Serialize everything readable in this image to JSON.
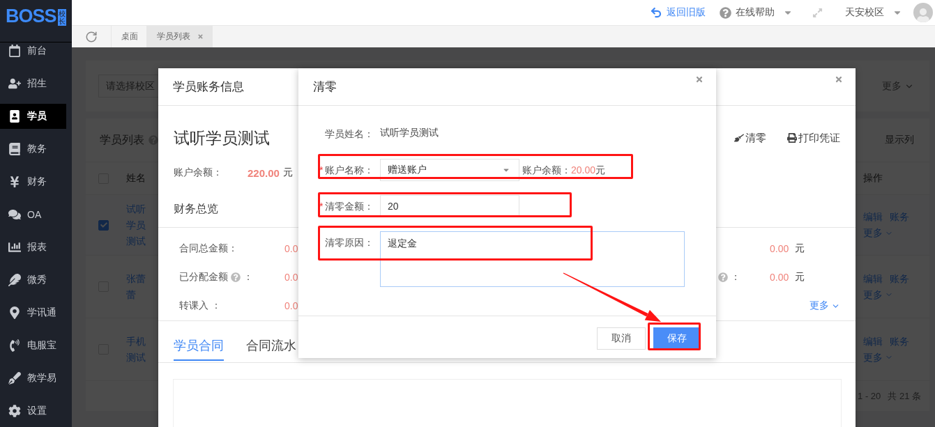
{
  "sidebar": {
    "logo": "BOSS",
    "logo_badge": "校长",
    "items": [
      {
        "label": "前台",
        "selected": false
      },
      {
        "label": "招生",
        "selected": false
      },
      {
        "label": "学员",
        "selected": true
      },
      {
        "label": "教务",
        "selected": false
      },
      {
        "label": "财务",
        "selected": false
      },
      {
        "label": "OA",
        "selected": false
      },
      {
        "label": "报表",
        "selected": false
      },
      {
        "label": "微秀",
        "selected": false
      },
      {
        "label": "学讯通",
        "selected": false
      },
      {
        "label": "电服宝",
        "selected": false
      },
      {
        "label": "教学易",
        "selected": false
      },
      {
        "label": "设置",
        "selected": false
      }
    ]
  },
  "topbar": {
    "back_link": "返回旧版",
    "help": "在线帮助",
    "campus": "天安校区"
  },
  "tabs": [
    {
      "label": "桌面",
      "selected": false,
      "closable": false
    },
    {
      "label": "学员列表",
      "selected": true,
      "closable": true
    }
  ],
  "background": {
    "header_checked": false,
    "campus_select": {
      "placeholder": "请选择校区"
    },
    "more": "更多",
    "list_title": "学员列表",
    "show_columns": "显示列",
    "columns": [
      "姓名",
      "操作"
    ],
    "rows": [
      {
        "name": "试听学员测试",
        "checked": true,
        "actions": [
          "编辑",
          "账务",
          "更多"
        ]
      },
      {
        "name": "张蕾蕾",
        "checked": false,
        "actions": [
          "编辑",
          "账务",
          "更多"
        ]
      },
      {
        "name": "手机测试",
        "checked": false,
        "actions": [
          "编辑",
          "账务",
          "更多"
        ]
      }
    ],
    "pagination": {
      "range": "1 - 20",
      "total": "共 21 条"
    }
  },
  "account_dialog": {
    "title": "学员账务信息",
    "student_name": "试听学员测试",
    "actions": [
      {
        "kind": "clear",
        "label": "清零"
      },
      {
        "kind": "print",
        "label": "打印凭证"
      }
    ],
    "balance": {
      "label": "账户余额：",
      "value": "220.00",
      "unit": "元"
    },
    "overview_title": "财务总览",
    "stats": [
      {
        "label": "合同总金额：",
        "value": "0.0",
        "right_value": "0.00",
        "right_unit": "元"
      },
      {
        "label": "已分配金额",
        "help": true,
        "suffix": "：",
        "value": "0.0",
        "right_help": true,
        "right_suffix": "：",
        "right_value": "0.00",
        "right_unit": "元"
      },
      {
        "label": "转课入 ：",
        "value": "0.0",
        "right_link": "更多"
      }
    ],
    "tabs": [
      {
        "label": "学员合同",
        "selected": true
      },
      {
        "label": "合同流水",
        "selected": false
      }
    ]
  },
  "clear_dialog": {
    "title": "清零",
    "fields": [
      {
        "kind": "text",
        "label": "学员姓名：",
        "value": "试听学员测试"
      },
      {
        "kind": "select",
        "mark": "*",
        "label": "账户名称：",
        "value": "赠送账户",
        "highlighted": true,
        "balance_label": "账户余额：",
        "balance_value": "20.00",
        "balance_unit": "元"
      },
      {
        "kind": "input",
        "mark": "*",
        "label": "清零金额：",
        "value": "20",
        "highlighted": true
      },
      {
        "kind": "textarea",
        "label": "清零原因：",
        "value": "退定金",
        "highlighted": true
      }
    ],
    "buttons": [
      {
        "kind": "cancel",
        "label": "取消",
        "highlighted": false
      },
      {
        "kind": "primary",
        "label": "保存",
        "highlighted": true
      }
    ],
    "arrow": true
  }
}
